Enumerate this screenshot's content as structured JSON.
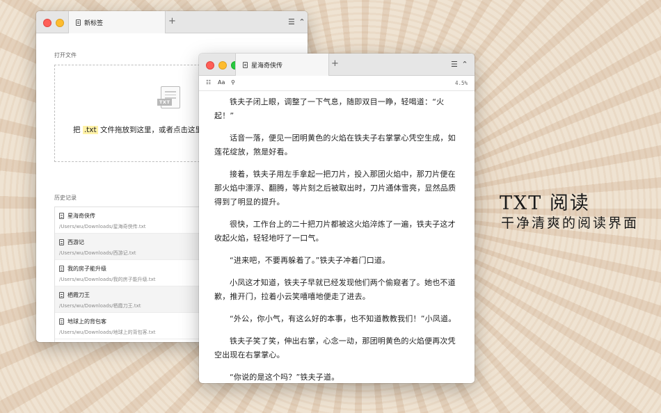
{
  "back_window": {
    "tab_title": "新标签",
    "new_tab_symbol": "+",
    "menu_symbol": "☰ ⌃",
    "open_file_label": "打开文件",
    "drop_text_before": "把",
    "drop_ext": ".txt",
    "drop_text_after": "文件拖放到这里，或者点击这里",
    "txt_badge": "TXT",
    "history_label": "历史记录",
    "history": [
      {
        "title": "星海奇侠传",
        "path": "/Users/wu/Downloads/星海奇侠传.txt"
      },
      {
        "title": "西游记",
        "path": "/Users/wu/Downloads/西游记.txt"
      },
      {
        "title": "我的房子能升级",
        "path": "/Users/wu/Downloads/我的房子能升级.txt"
      },
      {
        "title": "栖霞刀王",
        "path": "/Users/wu/Downloads/栖霞刀王.txt"
      },
      {
        "title": "地球上的背包客",
        "path": "/Users/wu/Downloads/地球上的背包客.txt"
      }
    ]
  },
  "front_window": {
    "tab_title": "星海奇侠传",
    "new_tab_symbol": "+",
    "menu_symbol": "☰ ⌃",
    "toolbar": {
      "list_icon": "☷",
      "font_label": "Aa",
      "search_icon": "⚲",
      "progress": "4.5%"
    },
    "paragraphs": [
      "铁夫子闭上眼，调整了一下气息，随即双目一睁，轻喝道：“火起！”",
      "话音一落，便见一团明黄色的火焰在铁夫子右掌掌心凭空生成，如莲花绽放，煞是好看。",
      "接着，铁夫子用左手拿起一把刀片，投入那团火焰中，那刀片便在那火焰中漂浮、翻腾，等片刻之后被取出时，刀片通体雪亮，显然品质得到了明显的提升。",
      "很快，工作台上的二十把刀片都被这火焰淬炼了一遍，铁夫子这才收起火焰，轻轻地吁了一口气。",
      "“进来吧，不要再躲着了。”铁夫子冲着门口道。",
      "小凤这才知道，铁夫子早就已经发现他们两个偷窥者了。她也不道歉，推开门，拉着小云笑嘻嘻地便走了进去。",
      "“外公，你小气，有这么好的本事，也不知道教教我们！”小凤道。",
      "铁夫子笑了笑，伸出右掌，心念一动，那团明黄色的火焰便再次凭空出现在右掌掌心。",
      "“你说的是这个吗？”铁夫子道。"
    ]
  },
  "promo": {
    "title": "TXT 阅读",
    "subtitle": "干净清爽的阅读界面"
  }
}
